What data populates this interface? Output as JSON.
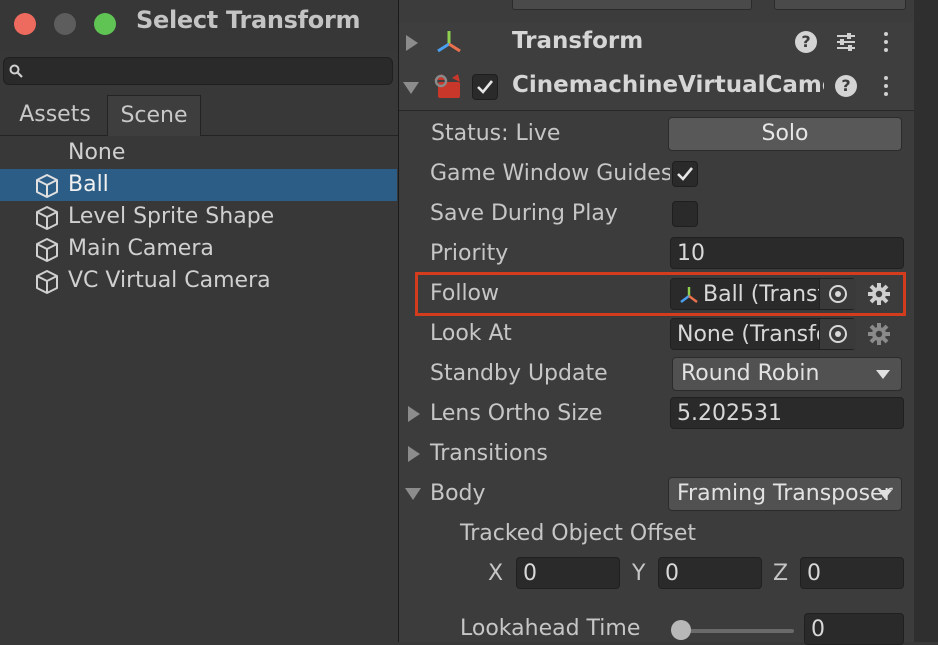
{
  "select_window": {
    "title": "Select Transform",
    "search": {
      "value": "",
      "placeholder": ""
    },
    "tabs": [
      {
        "label": "Assets"
      },
      {
        "label": "Scene"
      }
    ],
    "items": [
      {
        "label": "None"
      },
      {
        "label": "Ball"
      },
      {
        "label": "Level Sprite Shape"
      },
      {
        "label": "Main Camera"
      },
      {
        "label": "VC Virtual Camera"
      }
    ]
  },
  "inspector": {
    "transform": {
      "title": "Transform"
    },
    "cinemachine": {
      "title": "CinemachineVirtualCamera",
      "status_label": "Status: Live",
      "solo_label": "Solo",
      "game_window_guides_label": "Game Window Guides",
      "save_during_play_label": "Save During Play",
      "priority_label": "Priority",
      "priority_value": "10",
      "follow_label": "Follow",
      "follow_value": "Ball (Transform)",
      "look_at_label": "Look At",
      "look_at_value": "None (Transform)",
      "standby_update_label": "Standby Update",
      "standby_update_value": "Round Robin",
      "lens_ortho_size_label": "Lens Ortho Size",
      "lens_ortho_size_value": "5.202531",
      "transitions_label": "Transitions",
      "body_label": "Body",
      "body_value": "Framing Transposer",
      "tracked_object_offset_label": "Tracked Object Offset",
      "offset": {
        "x_label": "X",
        "x_value": "0",
        "y_label": "Y",
        "y_value": "0",
        "z_label": "Z",
        "z_value": "0"
      },
      "lookahead_time_label": "Lookahead Time",
      "lookahead_time_value": "0"
    }
  }
}
